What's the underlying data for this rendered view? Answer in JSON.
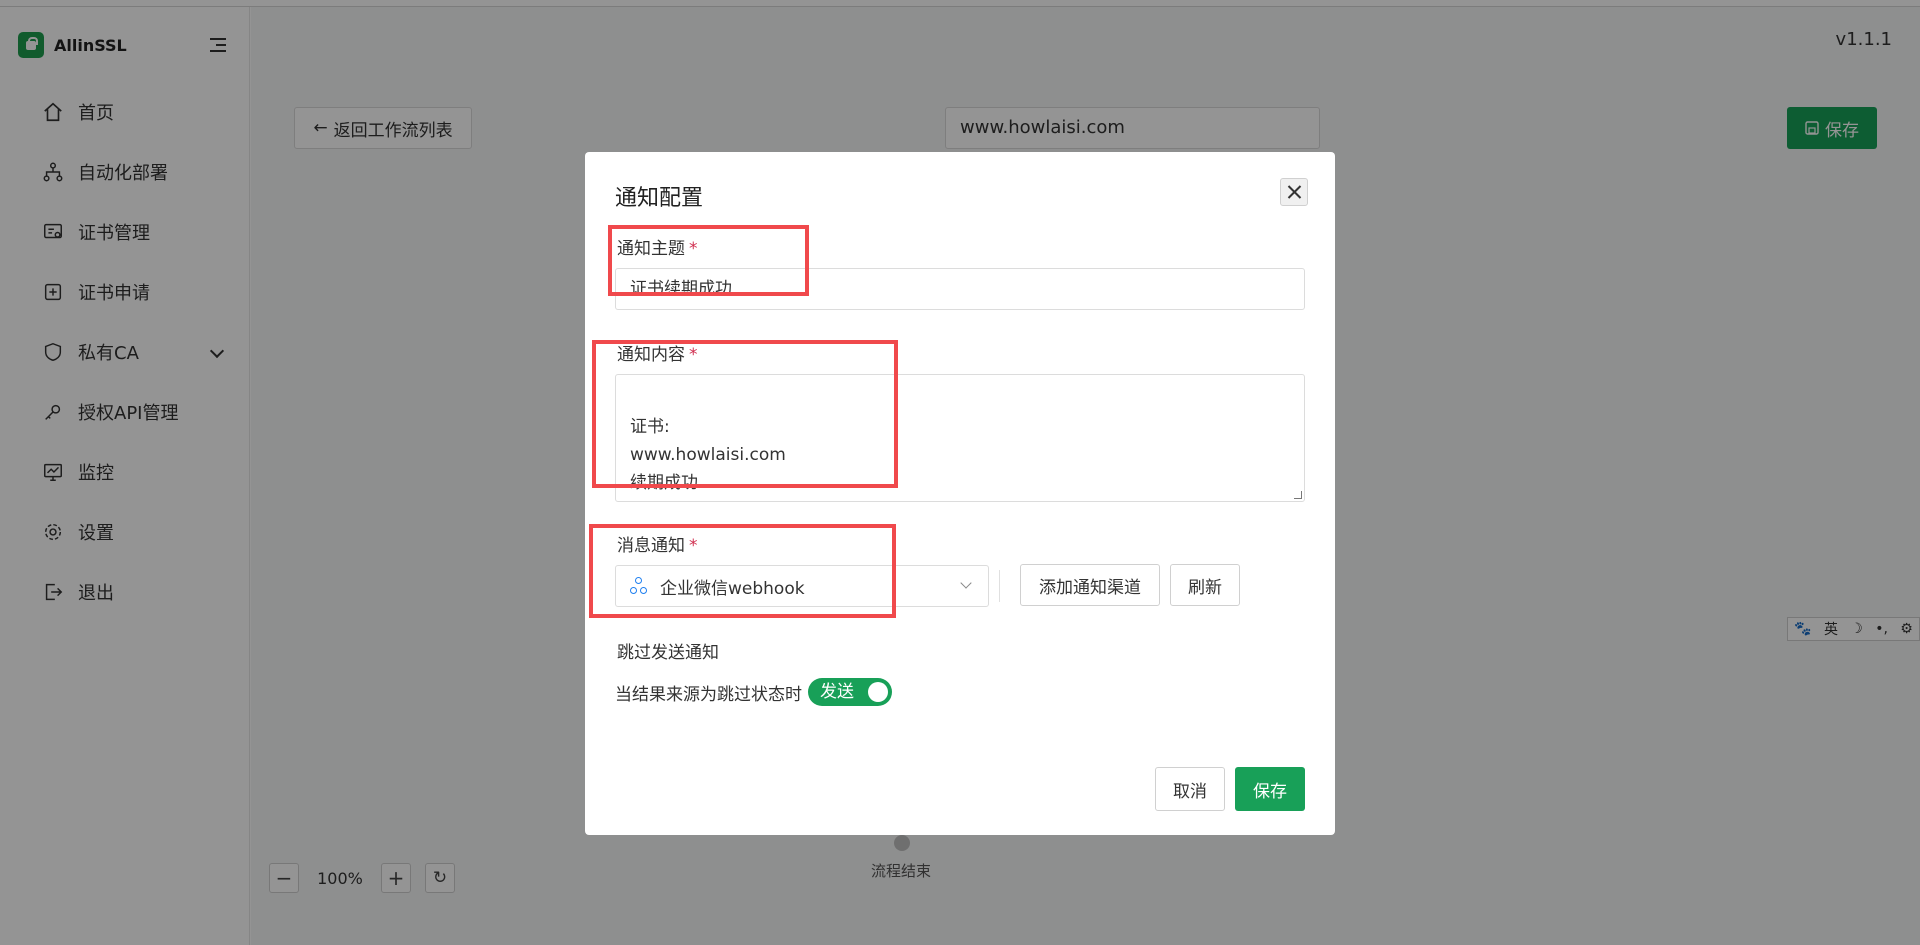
{
  "app": {
    "brand": "AllinSSL",
    "version": "v1.1.1"
  },
  "sidebar": {
    "items": [
      {
        "label": "首页",
        "icon": "home-icon"
      },
      {
        "label": "自动化部署",
        "icon": "workflow-icon"
      },
      {
        "label": "证书管理",
        "icon": "certificate-icon"
      },
      {
        "label": "证书申请",
        "icon": "plus-square-icon"
      },
      {
        "label": "私有CA",
        "icon": "shield-icon"
      },
      {
        "label": "授权API管理",
        "icon": "api-key-icon"
      },
      {
        "label": "监控",
        "icon": "monitor-icon"
      },
      {
        "label": "设置",
        "icon": "gear-icon"
      },
      {
        "label": "退出",
        "icon": "logout-icon"
      }
    ]
  },
  "toolbar": {
    "back_label": "返回工作流列表",
    "workflow_name": "www.howlaisi.com",
    "save_label": "保存"
  },
  "canvas": {
    "zoom_level": "100%",
    "flow_end_label": "流程结束"
  },
  "ime": {
    "lang": "英"
  },
  "dialog": {
    "title": "通知配置",
    "subject": {
      "label": "通知主题",
      "value": "证书续期成功"
    },
    "content": {
      "label": "通知内容",
      "value": "证书:\nwww.howlaisi.com\n续期成功"
    },
    "channel": {
      "label": "消息通知",
      "selected": "企业微信webhook",
      "add_label": "添加通知渠道",
      "refresh_label": "刷新"
    },
    "skip": {
      "label": "跳过发送通知",
      "description": "当结果来源为跳过状态时",
      "switch_text": "发送"
    },
    "cancel_label": "取消",
    "save_label": "保存"
  },
  "colors": {
    "primary": "#18a058",
    "required": "#d03050",
    "annotation": "#f0494c"
  }
}
